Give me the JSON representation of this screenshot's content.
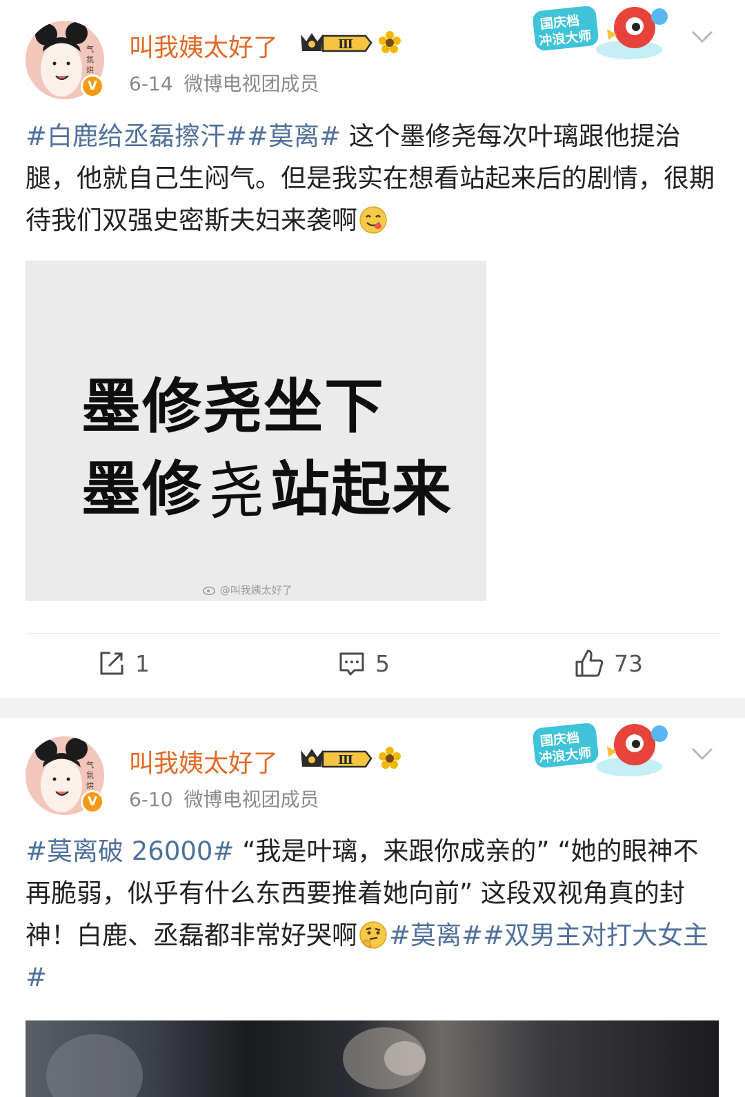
{
  "posts": [
    {
      "username": "叫我姨太好了",
      "date": "6-14",
      "source": "微博电视团成员",
      "level_badge": "Ⅲ",
      "promo_badge": "国庆档冲浪大师",
      "text": {
        "tag1": "#白鹿给丞磊擦汗#",
        "tag2": "#莫离#",
        "body_a": " 这个墨修尧每次叶璃跟他提治腿，他就自己生闷气。但是我实在想看站起来后的剧情，很期待我们双强史密斯夫妇来袭啊"
      },
      "image": {
        "line1": "墨修尧坐下",
        "line2_a": "墨修",
        "line2_hand": "尧",
        "line2_b": "站起来",
        "watermark": "@叫我姨太好了"
      },
      "actions": {
        "repost": "1",
        "comment": "5",
        "like": "73"
      }
    },
    {
      "username": "叫我姨太好了",
      "date": "6-10",
      "source": "微博电视团成员",
      "level_badge": "Ⅲ",
      "promo_badge": "国庆档冲浪大师",
      "text": {
        "tag1": "#莫离破 26000#",
        "body_a": " “我是叶璃，来跟你成亲的” “她的眼神不再脆弱，似乎有什么东西要推着她向前” 这段双视角真的封神！白鹿、丞磊都非常好哭啊",
        "tag2": "#莫离#",
        "tag3": "#双男主对打大女主#"
      }
    }
  ],
  "colors": {
    "username": "#e16a25",
    "tag": "#50709b",
    "meta": "#8a8a8a",
    "verified": "#f59a11"
  },
  "icons": [
    "avatar",
    "verified-icon",
    "crown-level-icon",
    "flower-icon",
    "promo-badge",
    "chevron-down-icon",
    "repost-icon",
    "comment-icon",
    "like-icon",
    "yum-emoji-icon",
    "thinking-emoji-icon"
  ]
}
